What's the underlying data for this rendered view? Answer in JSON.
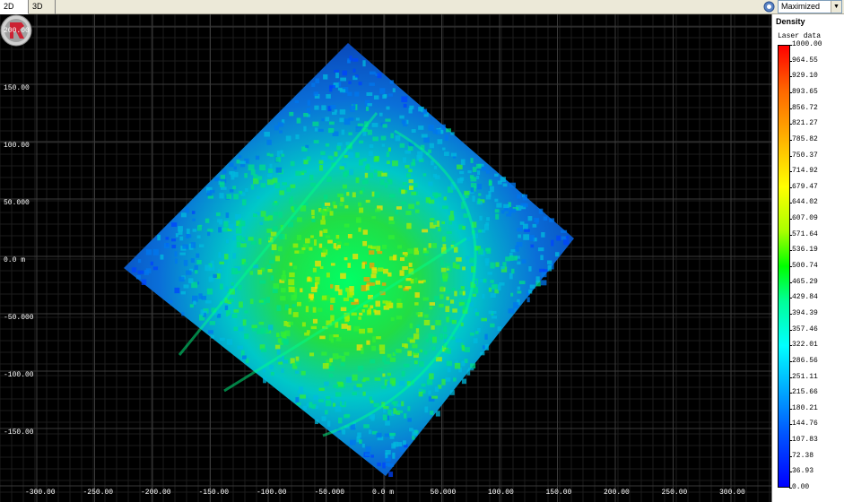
{
  "tabs": [
    {
      "label": "2D",
      "active": true
    },
    {
      "label": "3D",
      "active": false
    }
  ],
  "toolbar": {
    "view_mode": "Maximized",
    "view_icon": "view-options-icon"
  },
  "plot": {
    "y_unit": "m",
    "x_unit": "m",
    "y_ticks": [
      "200.00",
      "150.00",
      "100.00",
      "50.000",
      "0.0 m",
      "-50.000",
      "-100.00",
      "-150.00"
    ],
    "x_ticks": [
      "-300.00",
      "-250.00",
      "-200.00",
      "-150.00",
      "-100.00",
      "-50.000",
      "0.0 m",
      "50.000",
      "100.00",
      "150.00",
      "200.00",
      "250.00",
      "300.00"
    ],
    "background": "#000000",
    "grid_color": "#3a3a3a"
  },
  "legend": {
    "title": "Density",
    "subtitle": "Laser data",
    "ticks": [
      "1000.00",
      "964.55",
      "929.10",
      "893.65",
      "856.72",
      "821.27",
      "785.82",
      "750.37",
      "714.92",
      "679.47",
      "644.02",
      "607.09",
      "571.64",
      "536.19",
      "500.74",
      "465.29",
      "429.84",
      "394.39",
      "357.46",
      "322.01",
      "286.56",
      "251.11",
      "215.66",
      "180.21",
      "144.76",
      "107.83",
      "72.38",
      "36.93",
      "0.00"
    ]
  },
  "colors": {
    "low": "#0000ff",
    "mid": "#00ff00",
    "high": "#ff0000"
  }
}
